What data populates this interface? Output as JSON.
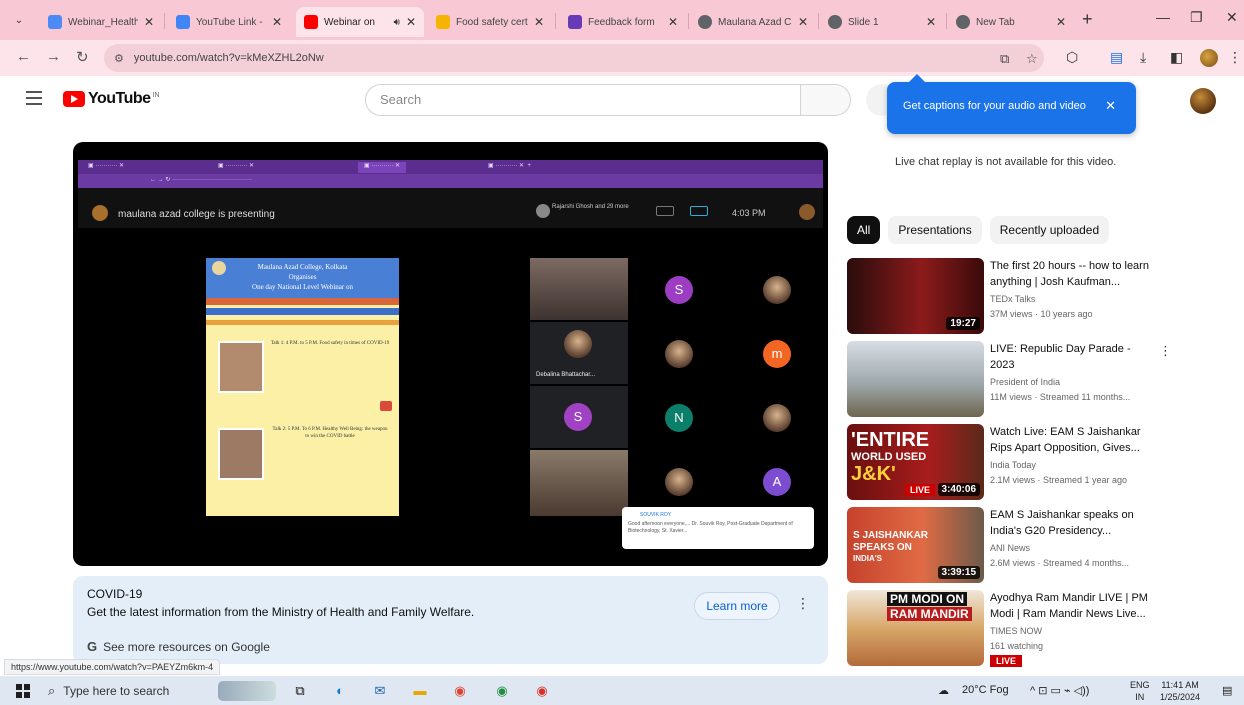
{
  "browser": {
    "tabs": [
      {
        "title": "Webinar_Health",
        "color": "#4c8bf5"
      },
      {
        "title": "YouTube Link - L",
        "color": "#4285f4"
      },
      {
        "title": "Webinar on",
        "color": "#ff0000",
        "active": true
      },
      {
        "title": "Food safety cert",
        "color": "#f4b400"
      },
      {
        "title": "Feedback form",
        "color": "#673ab7"
      },
      {
        "title": "Maulana Azad C",
        "color": "#5f6368"
      },
      {
        "title": "Slide 1",
        "color": "#5f6368"
      },
      {
        "title": "New Tab",
        "color": "#5f6368"
      }
    ],
    "url": "youtube.com/watch?v=kMeXZHL2oNw",
    "status_url": "https://www.youtube.com/watch?v=PAEYZm6km-4"
  },
  "youtube": {
    "logo": "YouTube",
    "logo_super": "IN",
    "search_placeholder": "Search",
    "caption_popup": "Get captions for your audio and video",
    "live_chat_note": "Live chat replay is not available for this video.",
    "chips": [
      "All",
      "Presentations",
      "Recently uploaded"
    ]
  },
  "player": {
    "meet_title": "maulana azad college is presenting",
    "presenter": "Rajarshi Ghosh and 29 more",
    "time": "4:03 PM",
    "participant_name": "Debalina Bhattachar...",
    "chat_name": "SOUVIK ROY",
    "chat_text": "Good afternoon everyone,... Dr. Souvik Roy, Post-Graduate Department of Biotechnology, St. Xavier...",
    "slide": {
      "line1": "Maulana Azad College, Kolkata",
      "line2": "Organises",
      "line3": "One day National Level Webinar on",
      "talk1": "Talk 1: 4 P.M. to 5 P.M. Food safety in times of COVID-19",
      "talk2": "Talk 2: 5 P.M. To 6 P.M. Healthy Well Being: the weapon to win the COVID battle"
    },
    "letters": [
      "S",
      "m",
      "S",
      "N",
      "A"
    ]
  },
  "recommendations": [
    {
      "title": "The first 20 hours -- how to learn anything | Josh Kaufman...",
      "channel": "TEDx Talks",
      "meta": "37M views · 10 years ago",
      "duration": "19:27"
    },
    {
      "title": "LIVE: Republic Day Parade - 2023",
      "channel": "President of India",
      "meta": "11M views · Streamed 11 months...",
      "duration": ""
    },
    {
      "title": "Watch Live: EAM S Jaishankar Rips Apart Opposition, Gives...",
      "channel": "India Today",
      "meta": "2.1M views · Streamed 1 year ago",
      "duration": "3:40:06",
      "thumb_lines": [
        "'ENTIRE",
        "WORLD USED",
        "J&K'",
        "LIVE"
      ]
    },
    {
      "title": "EAM S Jaishankar speaks on India's G20 Presidency...",
      "channel": "ANI News",
      "meta": "2.6M views · Streamed 4 months...",
      "duration": "3:39:15",
      "thumb_lines": [
        "S JAISHANKAR",
        "SPEAKS ON",
        "INDIA'S"
      ]
    },
    {
      "title": "Ayodhya Ram Mandir LIVE | PM Modi | Ram Mandir News Live...",
      "channel": "TIMES NOW",
      "meta": "161 watching",
      "live_badge": "LIVE",
      "thumb_lines": [
        "PM MODI ON",
        "RAM MANDIR"
      ]
    }
  ],
  "covid": {
    "title": "COVID-19",
    "desc": "Get the latest information from the Ministry of Health and Family Welfare.",
    "button": "Learn more",
    "resources": "See more resources on Google"
  },
  "taskbar": {
    "search": "Type here to search",
    "weather": "20°C Fog",
    "lang_top": "ENG",
    "lang_bottom": "IN",
    "time": "11:41 AM",
    "date": "1/25/2024"
  }
}
